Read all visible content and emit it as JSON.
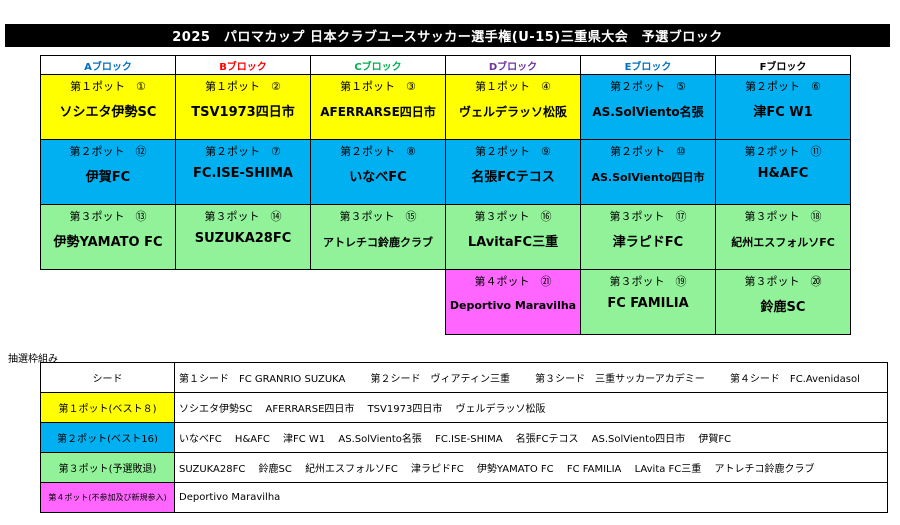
{
  "title": "2025　パロマカップ 日本クラブユースサッカー選手権(U-15)三重県大会　予選ブロック",
  "blocks": [
    {
      "name": "Aブロック",
      "color": "#0070c0"
    },
    {
      "name": "Bブロック",
      "color": "#ff0000"
    },
    {
      "name": "Cブロック",
      "color": "#00b050"
    },
    {
      "name": "Dブロック",
      "color": "#7030a0"
    },
    {
      "name": "Eブロック",
      "color": "#0070c0"
    },
    {
      "name": "Fブロック",
      "color": "#000000"
    }
  ],
  "rows": [
    [
      {
        "pot": "第１ポット　①",
        "team": "ソシエタ伊勢SC"
      },
      {
        "pot": "第１ポット　②",
        "team": "TSV1973四日市"
      },
      {
        "pot": "第１ポット　③",
        "team": "AFERRARSE四日市"
      },
      {
        "pot": "第１ポット　④",
        "team": "ヴェルデラッソ松阪"
      },
      {
        "pot": "第２ポット　⑤",
        "team": "AS.SolViento名張"
      },
      {
        "pot": "第２ポット　⑥",
        "team": "津FC W1"
      }
    ],
    [
      {
        "pot": "第２ポット　⑫",
        "team": "伊賀FC"
      },
      {
        "pot": "第２ポット　⑦",
        "team": "FC.ISE-SHIMA"
      },
      {
        "pot": "第２ポット　⑧",
        "team": "いなべFC"
      },
      {
        "pot": "第２ポット　⑨",
        "team": "名張FCテコス"
      },
      {
        "pot": "第２ポット　⑩",
        "team": "AS.SolViento四日市"
      },
      {
        "pot": "第２ポット　⑪",
        "team": "H&AFC"
      }
    ],
    [
      {
        "pot": "第３ポット　⑬",
        "team": "伊勢YAMATO FC"
      },
      {
        "pot": "第３ポット　⑭",
        "team": "SUZUKA28FC"
      },
      {
        "pot": "第３ポット　⑮",
        "team": "アトレチコ鈴鹿クラブ"
      },
      {
        "pot": "第３ポット　⑯",
        "team": "LAvitaFC三重"
      },
      {
        "pot": "第３ポット　⑰",
        "team": "津ラピドFC"
      },
      {
        "pot": "第３ポット　⑱",
        "team": "紀州エスフォルソFC"
      }
    ],
    [
      {
        "pot": "第４ポット　㉑",
        "team": "Deportivo Maravilha"
      },
      {
        "pot": "第３ポット　⑲",
        "team": "FC FAMILIA"
      },
      {
        "pot": "第３ポット　⑳",
        "team": "鈴鹿SC"
      }
    ]
  ],
  "lots_label": "抽選枠組み",
  "seed_label": "シード",
  "seeds": [
    "第１シード　FC GRANRIO SUZUKA",
    "第２シード　ヴィアティン三重",
    "第３シード　三重サッカーアカデミー",
    "第４シード　FC.Avenidasol"
  ],
  "pots": [
    {
      "label": "第１ポット(ベスト８)",
      "teams": [
        "ソシエタ伊勢SC",
        "AFERRARSE四日市",
        "TSV1973四日市",
        "ヴェルデラッソ松阪"
      ]
    },
    {
      "label": "第２ポット(ベスト16)",
      "teams": [
        "いなべFC",
        "H&AFC",
        "津FC W1",
        "AS.SolViento名張",
        "FC.ISE-SHIMA",
        "名張FCテコス",
        "AS.SolViento四日市",
        "伊賀FC"
      ]
    },
    {
      "label": "第３ポット(予選敗退)",
      "teams": [
        "SUZUKA28FC",
        "鈴鹿SC",
        "紀州エスフォルソFC",
        "津ラピドFC",
        "伊勢YAMATO FC",
        "FC FAMILIA",
        "LAvita FC三重",
        "アトレチコ鈴鹿クラブ"
      ]
    },
    {
      "label": "第４ポット(不参加及び新規参入)",
      "teams": [
        "Deportivo Maravilha"
      ]
    }
  ],
  "colors": {
    "pot1": "#ffff00",
    "pot2": "#00b0f0",
    "pot3": "#92f29a",
    "pot4": "#ff66ff"
  }
}
